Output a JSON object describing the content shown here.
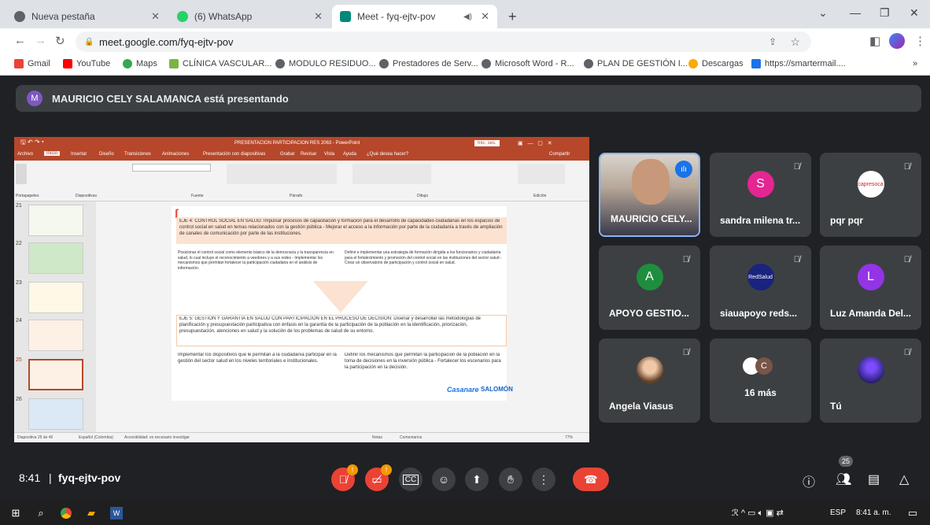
{
  "browser": {
    "tabs": [
      {
        "label": "Nueva pestaña",
        "color": "#5f6368"
      },
      {
        "label": "(6) WhatsApp",
        "color": "#25d366"
      },
      {
        "label": "Meet - fyq-ejtv-pov",
        "color": "#00897b"
      }
    ],
    "new_tab": "+",
    "url": "meet.google.com/fyq-ejtv-pov",
    "bookmarks": [
      "Gmail",
      "YouTube",
      "Maps",
      "CLÍNICA VASCULAR...",
      "MODULO RESIDUO...",
      "Prestadores de Serv...",
      "Microsoft Word - R...",
      "PLAN DE GESTIÓN I...",
      "Descargas",
      "https://smartermail...."
    ],
    "bookmarks_more": "»"
  },
  "meet": {
    "banner_initial": "M",
    "banner_text": "MAURICIO CELY SALAMANCA está presentando",
    "meeting_time": "8:41",
    "meeting_code": "fyq-ejtv-pov",
    "participant_count": "25",
    "participants": [
      {
        "name": "MAURICIO CELY...",
        "type": "video"
      },
      {
        "name": "sandra milena tr...",
        "initial": "S",
        "color": "#e52592"
      },
      {
        "name": "pqr pqr",
        "type": "logo",
        "logo_text": "capresoca"
      },
      {
        "name": "APOYO GESTIO...",
        "initial": "A",
        "color": "#1e8e3e"
      },
      {
        "name": "siauapoyo reds...",
        "type": "logo",
        "logo_text": "RedSalud"
      },
      {
        "name": "Luz Amanda Del...",
        "initial": "L",
        "color": "#9334e6"
      },
      {
        "name": "Angela Viasus",
        "type": "photo"
      },
      {
        "name": "16 más",
        "initial": "C",
        "type": "more"
      },
      {
        "name": "Tú",
        "type": "photo"
      }
    ]
  },
  "ppt": {
    "title": "PRESENTACION PARTICIPACION RES 2063 - PowerPoint",
    "signin": "Inic. ses.",
    "tabs": [
      "Archivo",
      "Inicio",
      "Insertar",
      "Diseño",
      "Transiciones",
      "Animaciones",
      "Presentación con diapositivas",
      "Grabar",
      "Revisar",
      "Vista",
      "Ayuda",
      "¿Qué desea hacer?",
      "Compartir"
    ],
    "ribbon_groups": [
      "Portapapeles",
      "Diapositivas",
      "Fuente",
      "Párrafo",
      "Dibujo",
      "Edición"
    ],
    "slide_numbers": [
      "21",
      "22",
      "23",
      "24",
      "25",
      "26"
    ],
    "eje4_title": "EJE 4: CONTROL SOCIAL EN SALUD: Impulsar procesos de capacitación y formación para el desarrollo de capacidades ciudadanas en los espacios de control social en salud en temas relacionados con la gestión pública - Mejorar el acceso a la información por parte de la ciudadanía a través de ampliación de canales de comunicación por parte de las instituciones.",
    "eje4_left": "Posicionar el control social como elemento básico de la democracia y la transparencia en salud, lo cual incluye el reconocimiento a veedores y a sus redes - Implementar los mecanismos que permitan fortalecer la participación ciudadana en el análisis de información.",
    "eje4_right": "Definir e implementar una estrategia de formación dirigida a los funcionarios y ciudadanía para el fortalecimiento y promoción del control social en las instituciones del sector salud - Crear un observatorio de participación y control social en salud.",
    "eje5_title": "EJE 5: GESTIÓN Y GARANTÍA EN SALUD CON PARTICIPACIÓN EN EL PROCESO DE DECISIÓN: Diseñar y desarrollar las metodologías de planificación y presupuestación participativa con énfasis en la garantía de la participación de la población en la identificación, priorización, presupuestación, atenciones en salud y la solución de los problemas de salud de su entorno.",
    "eje5_left": "Implementar los dispositivos que le permitan a la ciudadanía participar en la gestión del sector salud en los niveles territoriales e institucionales.",
    "eje5_right": "Definir los mecanismos que permitan la participación de la población en la toma de decisiones en la inversión pública - Fortalecer los escenarios para la participación en la decisión.",
    "logo1": "Casanare",
    "logo2": "SALOMÓN",
    "status_left": "Diapositiva 25 de 46",
    "status_lang": "Español (Colombia)",
    "status_access": "Accesibilidad: es necesario investigar",
    "status_notes": "Notas",
    "status_comments": "Comentarios",
    "zoom": "77%"
  },
  "taskbar": {
    "lang": "ESP",
    "time": "8:41 a. m."
  }
}
